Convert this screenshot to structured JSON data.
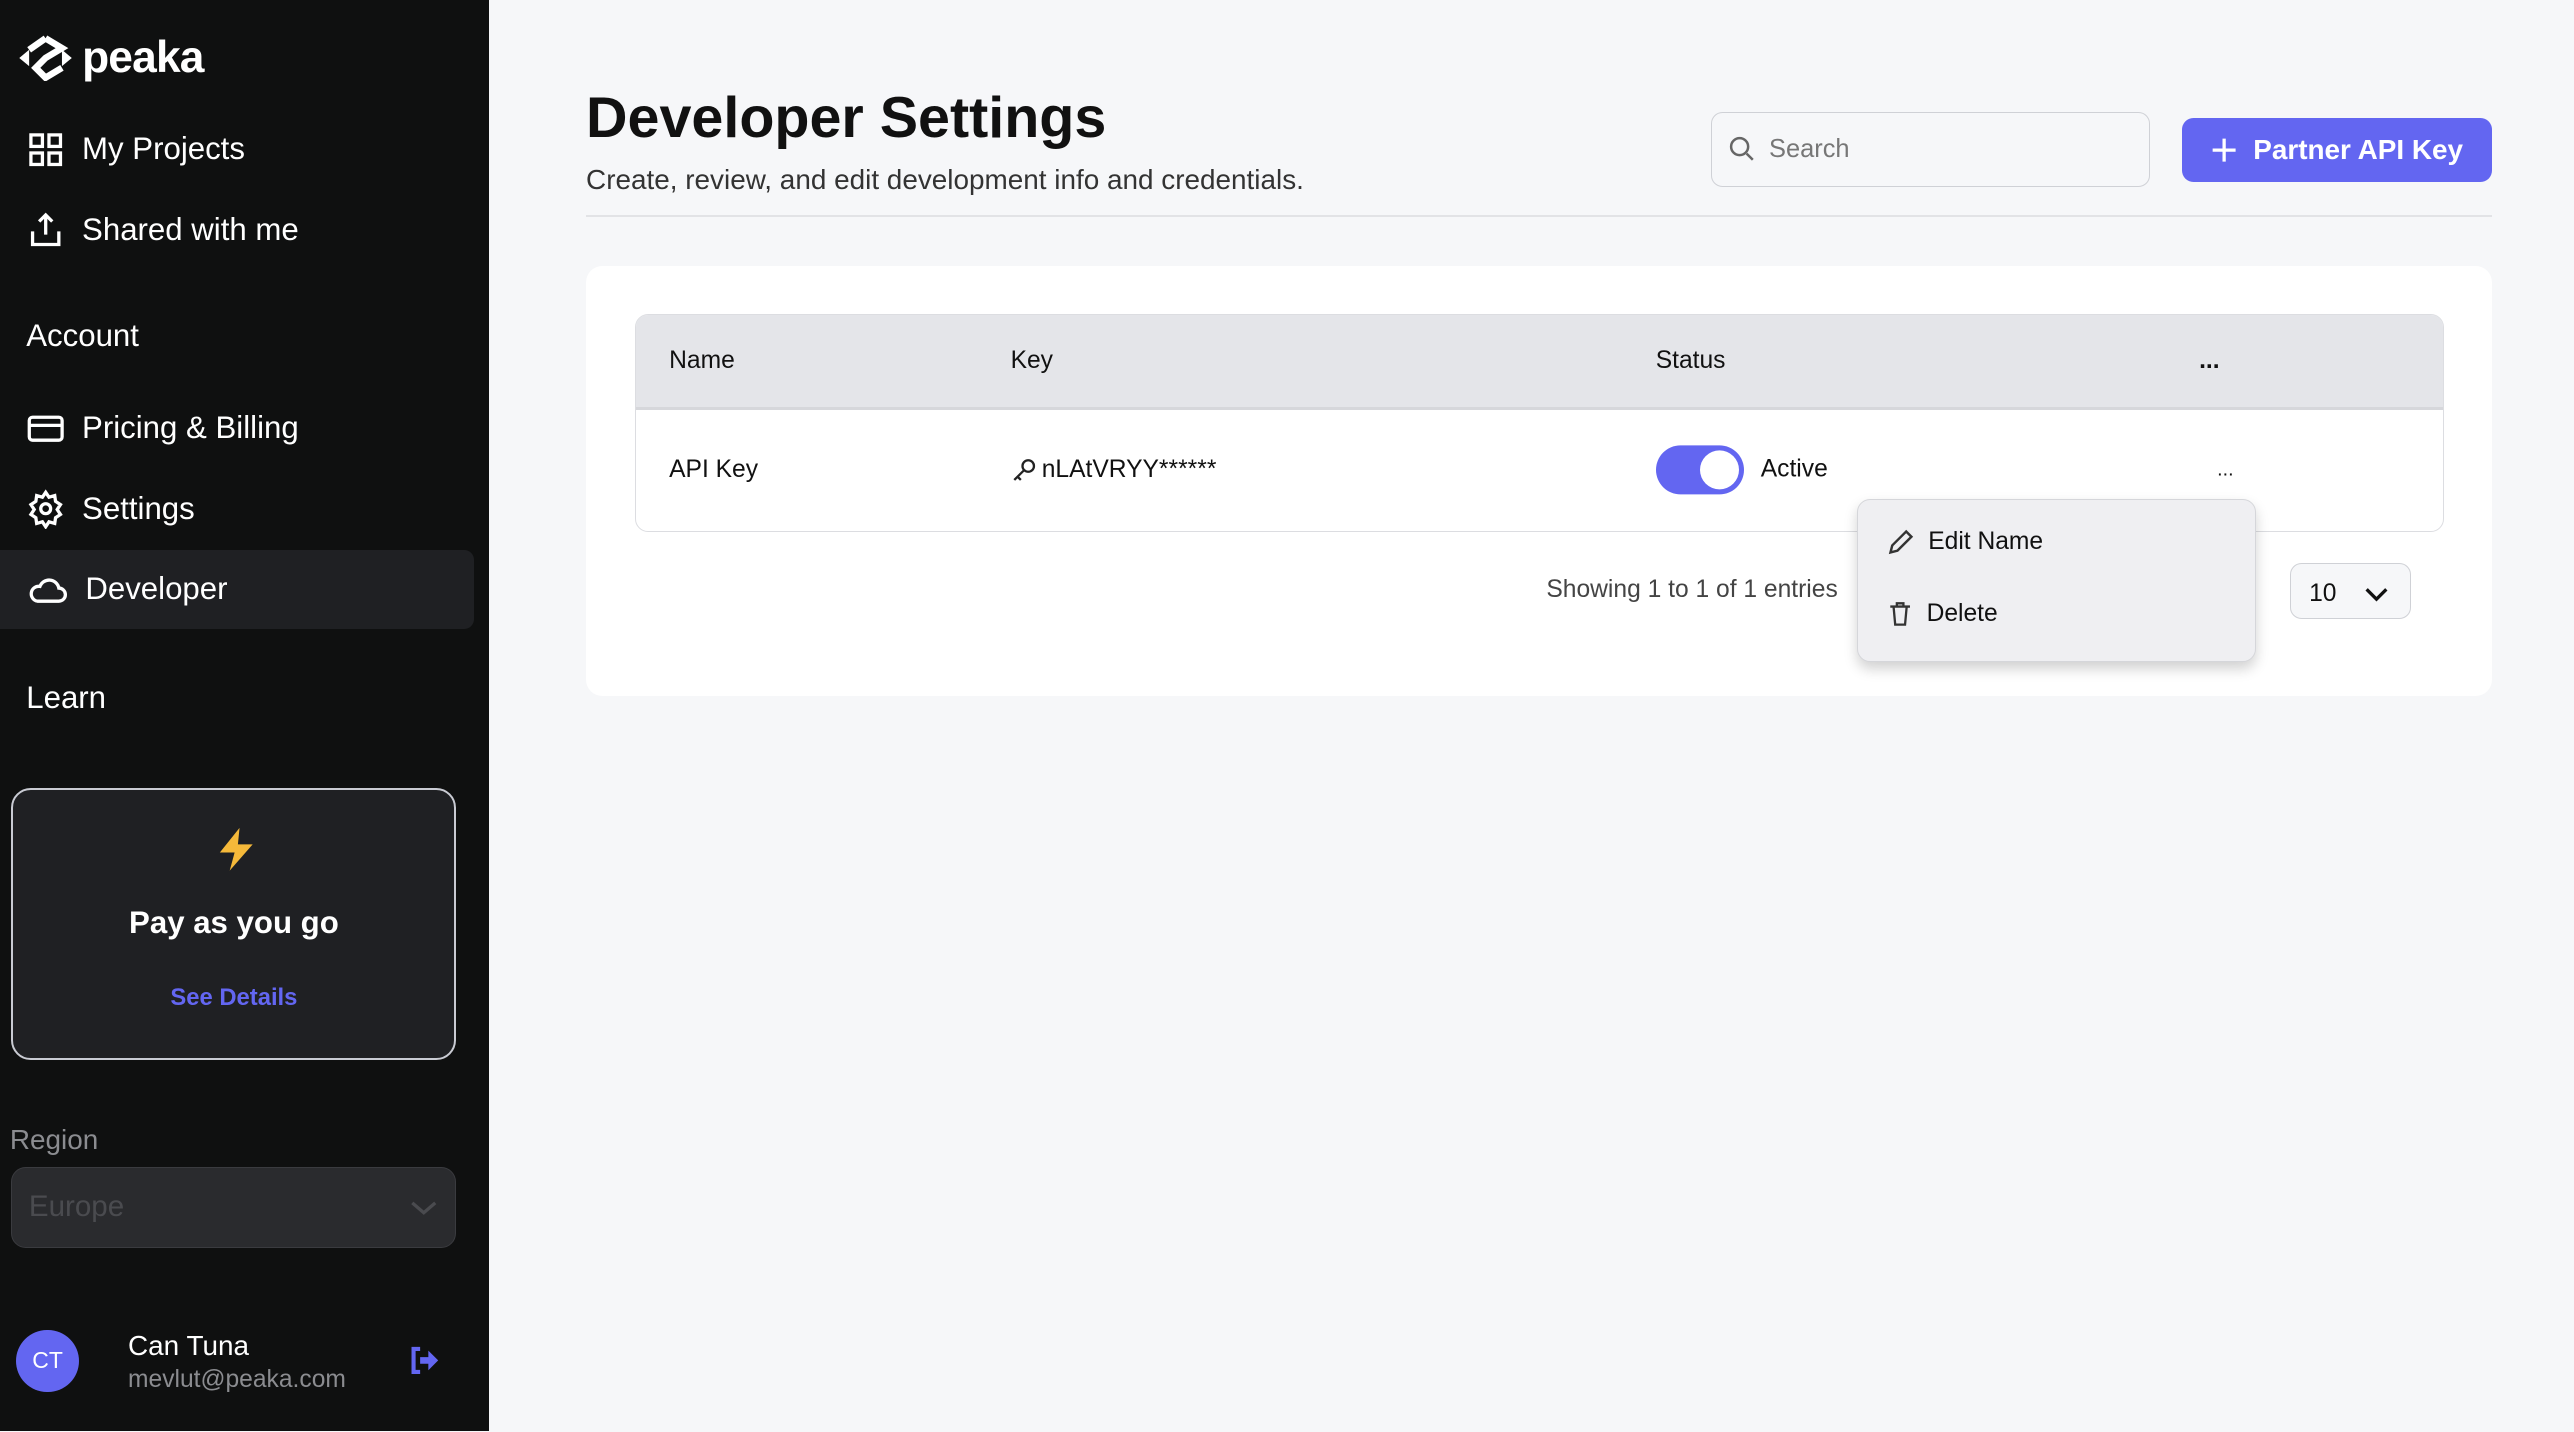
{
  "brand": {
    "name": "peaka"
  },
  "sidebar": {
    "top_items": [
      {
        "label": "My Projects",
        "icon": "grid-icon"
      },
      {
        "label": "Shared with me",
        "icon": "share-icon"
      }
    ],
    "account_heading": "Account",
    "account_items": [
      {
        "label": "Pricing & Billing",
        "icon": "credit-card-icon"
      },
      {
        "label": "Settings",
        "icon": "gear-icon"
      },
      {
        "label": "Developer",
        "icon": "cloud-icon",
        "active": true
      }
    ],
    "learn_heading": "Learn",
    "plan_card": {
      "title": "Pay as you go",
      "link": "See Details",
      "icon": "lightning-icon"
    },
    "region": {
      "label": "Region",
      "value": "Europe"
    },
    "user": {
      "initials": "CT",
      "name": "Can Tuna",
      "email": "mevlut@peaka.com"
    }
  },
  "header": {
    "title": "Developer Settings",
    "subtitle": "Create, review, and edit development info and credentials.",
    "search_placeholder": "Search",
    "primary_button": "Partner API Key"
  },
  "table": {
    "columns": [
      "Name",
      "Key",
      "Status",
      "..."
    ],
    "rows": [
      {
        "name": "API Key",
        "key": "nLAtVRYY******",
        "status": "Active",
        "enabled": true,
        "actions": "..."
      }
    ]
  },
  "pagination": {
    "summary": "Showing 1 to 1 of 1 entries",
    "page_size": "10"
  },
  "context_menu": {
    "items": [
      "Edit Name",
      "Delete"
    ]
  },
  "colors": {
    "accent": "#6366f1",
    "sidebar": "#0f1010",
    "background": "#f6f7f9"
  }
}
